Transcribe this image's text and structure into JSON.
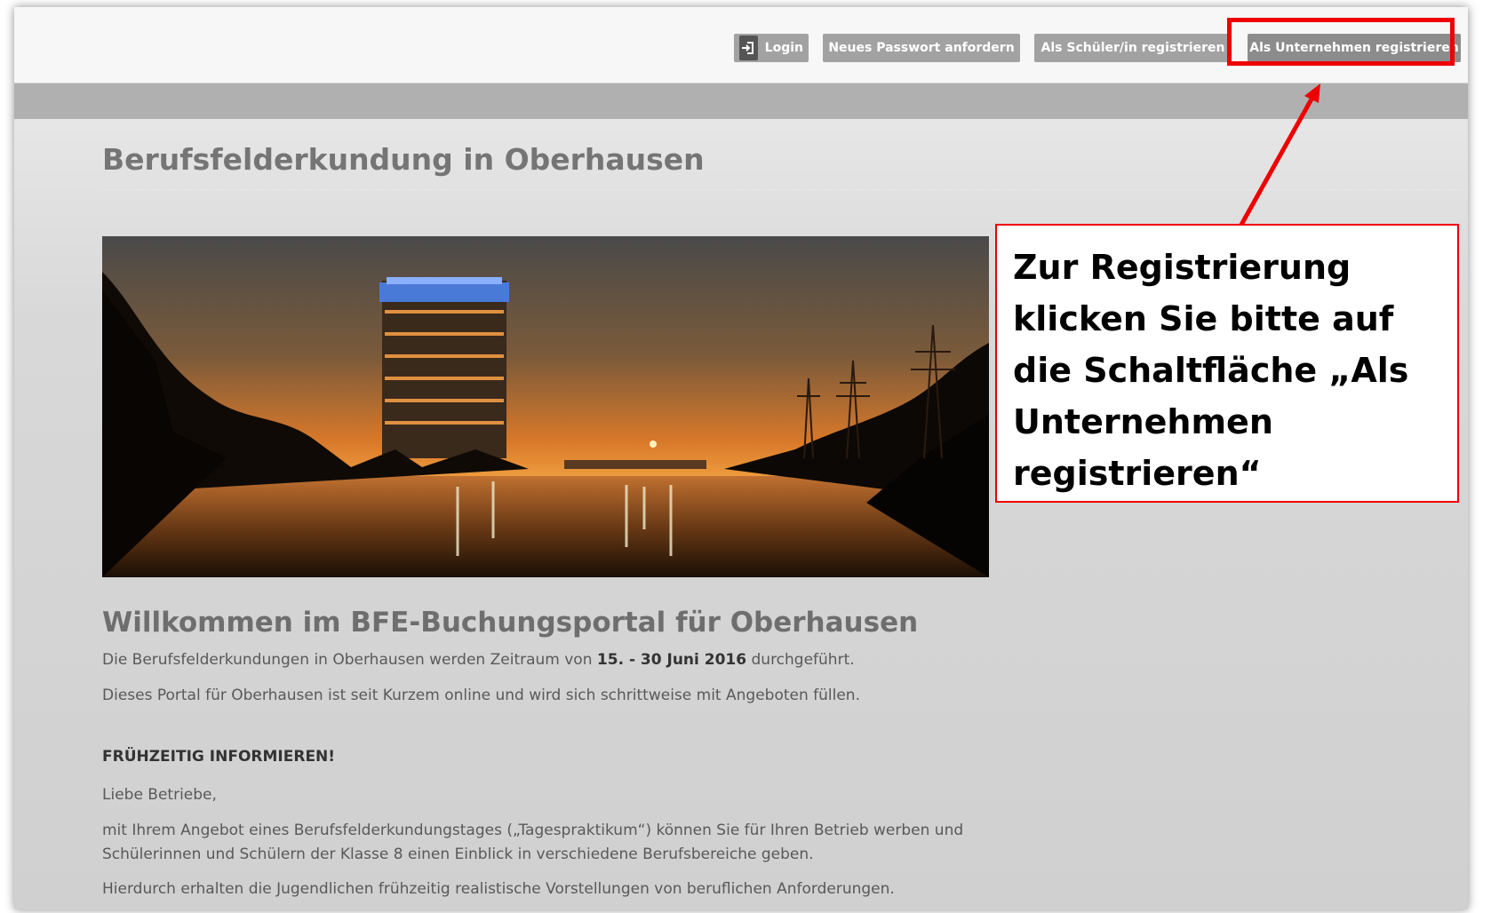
{
  "nav": {
    "login_label": "Login",
    "password_label": "Neues Passwort anfordern",
    "student_register_label": "Als Schüler/in registrieren",
    "company_register_label": "Als Unternehmen registrieren"
  },
  "page": {
    "title": "Berufsfelderkundung in Oberhausen",
    "welcome": "Willkommen im BFE-Buchungsportal für Oberhausen",
    "intro_pre": "Die Berufsfelderkundungen in Oberhausen werden Zeitraum von ",
    "intro_date": "15. - 30 Juni 2016",
    "intro_post": " durchgeführt.",
    "portal_text": "Dieses Portal für Oberhausen ist seit Kurzem online und wird sich schrittweise mit Angeboten füllen.",
    "section_heading": "FRÜHZEITIG INFORMIEREN!",
    "greeting": "Liebe Betriebe,",
    "offer_text": "mit Ihrem Angebot eines Berufsfelderkundungstages („Tagespraktikum“) können Sie für Ihren Betrieb werben und Schülerinnen und Schülern der Klasse 8 einen Einblick in verschiedene Berufsbereiche geben.",
    "closing_text": "Hierdurch erhalten die Jugendlichen frühzeitig realistische Vorstellungen von beruflichen Anforderungen."
  },
  "annotation": {
    "callout_text": "Zur Registrierung klicken Sie bitte auf die Schaltfläche „Als Unternehmen registrieren“",
    "color": "#ee0000"
  },
  "icons": {
    "login": "sign-in-icon"
  },
  "colors": {
    "button_bg": "#a2a2a2",
    "title_text": "#757575"
  }
}
